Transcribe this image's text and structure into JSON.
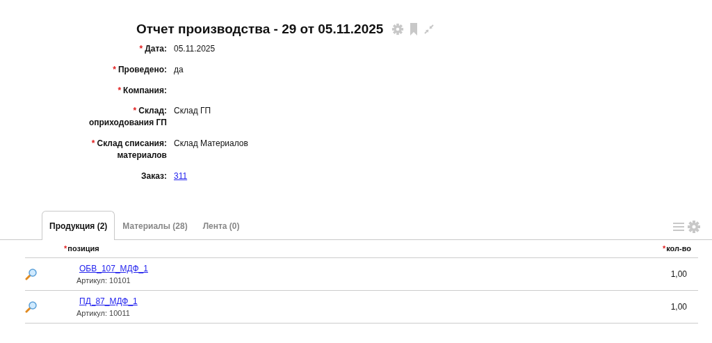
{
  "title": "Отчет производства - 29 от 05.11.2025",
  "fields": [
    {
      "mark": "*",
      "label": "Дата:",
      "value": "05.11.2025",
      "kind": "text"
    },
    {
      "mark": "*",
      "label": "Проведено:",
      "value": "да",
      "kind": "text"
    },
    {
      "mark": "*",
      "label": "Компания:"
    },
    {
      "mark": "*",
      "label": "Склад: оприходования ГП",
      "value": "Склад ГП",
      "kind": "text"
    },
    {
      "mark": "*",
      "label": "Склад списания: материалов",
      "value": "Склад Материалов",
      "kind": "text"
    },
    {
      "label": "Заказ:",
      "value": "311",
      "kind": "link"
    }
  ],
  "tabs": [
    {
      "label": "Продукция (2)",
      "selected": true
    },
    {
      "label": "Материалы (28)",
      "selected": false
    },
    {
      "label": "Лента (0)",
      "selected": false
    }
  ],
  "table": {
    "columns": [
      {
        "mark": "*",
        "label": "позиция"
      },
      {
        "mark": "*",
        "label": "кол-во"
      }
    ],
    "rows": [
      {
        "name": "ОБВ_107_МДФ_1",
        "article": "Артикул: 10101",
        "quantity": "1,00"
      },
      {
        "name": "ПД_87_МДФ_1",
        "article": "Артикул: 10011",
        "quantity": "1,00"
      }
    ]
  }
}
